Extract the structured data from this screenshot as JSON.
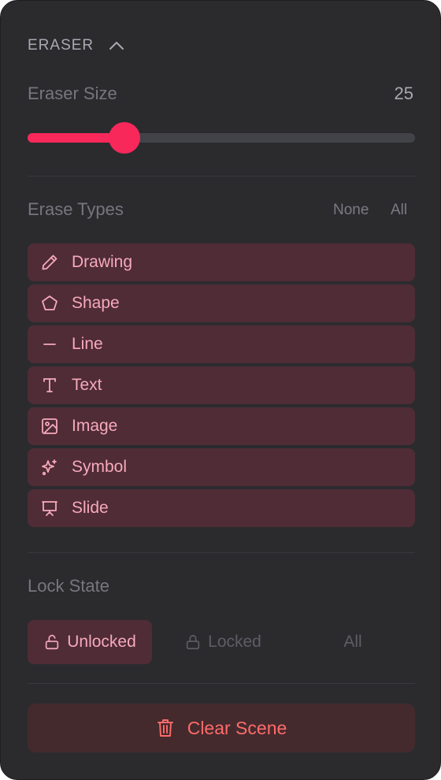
{
  "header": {
    "title": "ERASER",
    "collapse_icon": "chevron-up-icon"
  },
  "eraser_size": {
    "label": "Eraser Size",
    "value": "25",
    "level": 25,
    "max": 100
  },
  "erase_types": {
    "label": "Erase Types",
    "none_label": "None",
    "all_label": "All",
    "items": [
      {
        "label": "Drawing",
        "icon": "pencil-icon"
      },
      {
        "label": "Shape",
        "icon": "pentagon-icon"
      },
      {
        "label": "Line",
        "icon": "line-icon"
      },
      {
        "label": "Text",
        "icon": "text-icon"
      },
      {
        "label": "Image",
        "icon": "image-icon"
      },
      {
        "label": "Symbol",
        "icon": "sparkles-icon"
      },
      {
        "label": "Slide",
        "icon": "presentation-icon"
      }
    ]
  },
  "lock_state": {
    "label": "Lock State",
    "options": [
      {
        "label": "Unlocked",
        "icon": "unlock-icon",
        "selected": true
      },
      {
        "label": "Locked",
        "icon": "lock-icon",
        "selected": false
      },
      {
        "label": "All",
        "selected": false
      }
    ]
  },
  "clear_button": {
    "label": "Clear Scene",
    "icon": "trash-icon"
  },
  "colors": {
    "panel_bg": "#2b2b2e",
    "accent": "#f8285a",
    "item_bg": "#4f2c36",
    "item_text": "#f7a9bc",
    "danger_text": "#ff6b6b",
    "danger_bg": "#442a2d"
  }
}
